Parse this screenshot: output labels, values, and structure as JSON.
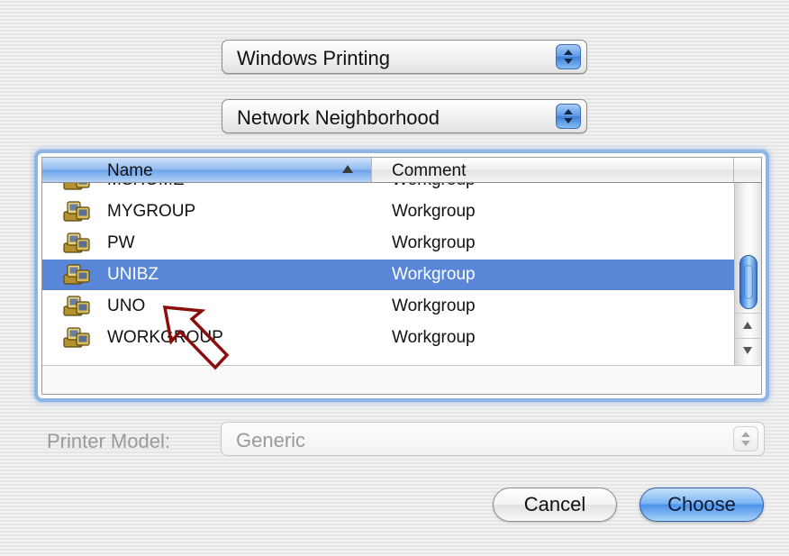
{
  "service_popup": {
    "value": "Windows Printing"
  },
  "location_popup": {
    "value": "Network Neighborhood"
  },
  "list": {
    "columns": {
      "name": "Name",
      "comment": "Comment"
    },
    "rows": [
      {
        "name": "MSHOME",
        "comment": "Workgroup"
      },
      {
        "name": "MYGROUP",
        "comment": "Workgroup"
      },
      {
        "name": "PW",
        "comment": "Workgroup"
      },
      {
        "name": "UNIBZ",
        "comment": "Workgroup",
        "selected": true
      },
      {
        "name": "UNO",
        "comment": "Workgroup"
      },
      {
        "name": "WORKGROUP",
        "comment": "Workgroup"
      }
    ]
  },
  "printer_model": {
    "label": "Printer Model:",
    "value": "Generic"
  },
  "buttons": {
    "cancel": "Cancel",
    "choose": "Choose"
  },
  "colors": {
    "selection": "#5a86d8",
    "accent_blue": "#4d93ea",
    "annotation_arrow": "#8a0e0e",
    "disabled_text": "#9a9a9a"
  },
  "icons": {
    "workgroup": "workgroup-icon",
    "sort": "sort-ascending-icon",
    "popup": "popup-stepper-icon"
  }
}
